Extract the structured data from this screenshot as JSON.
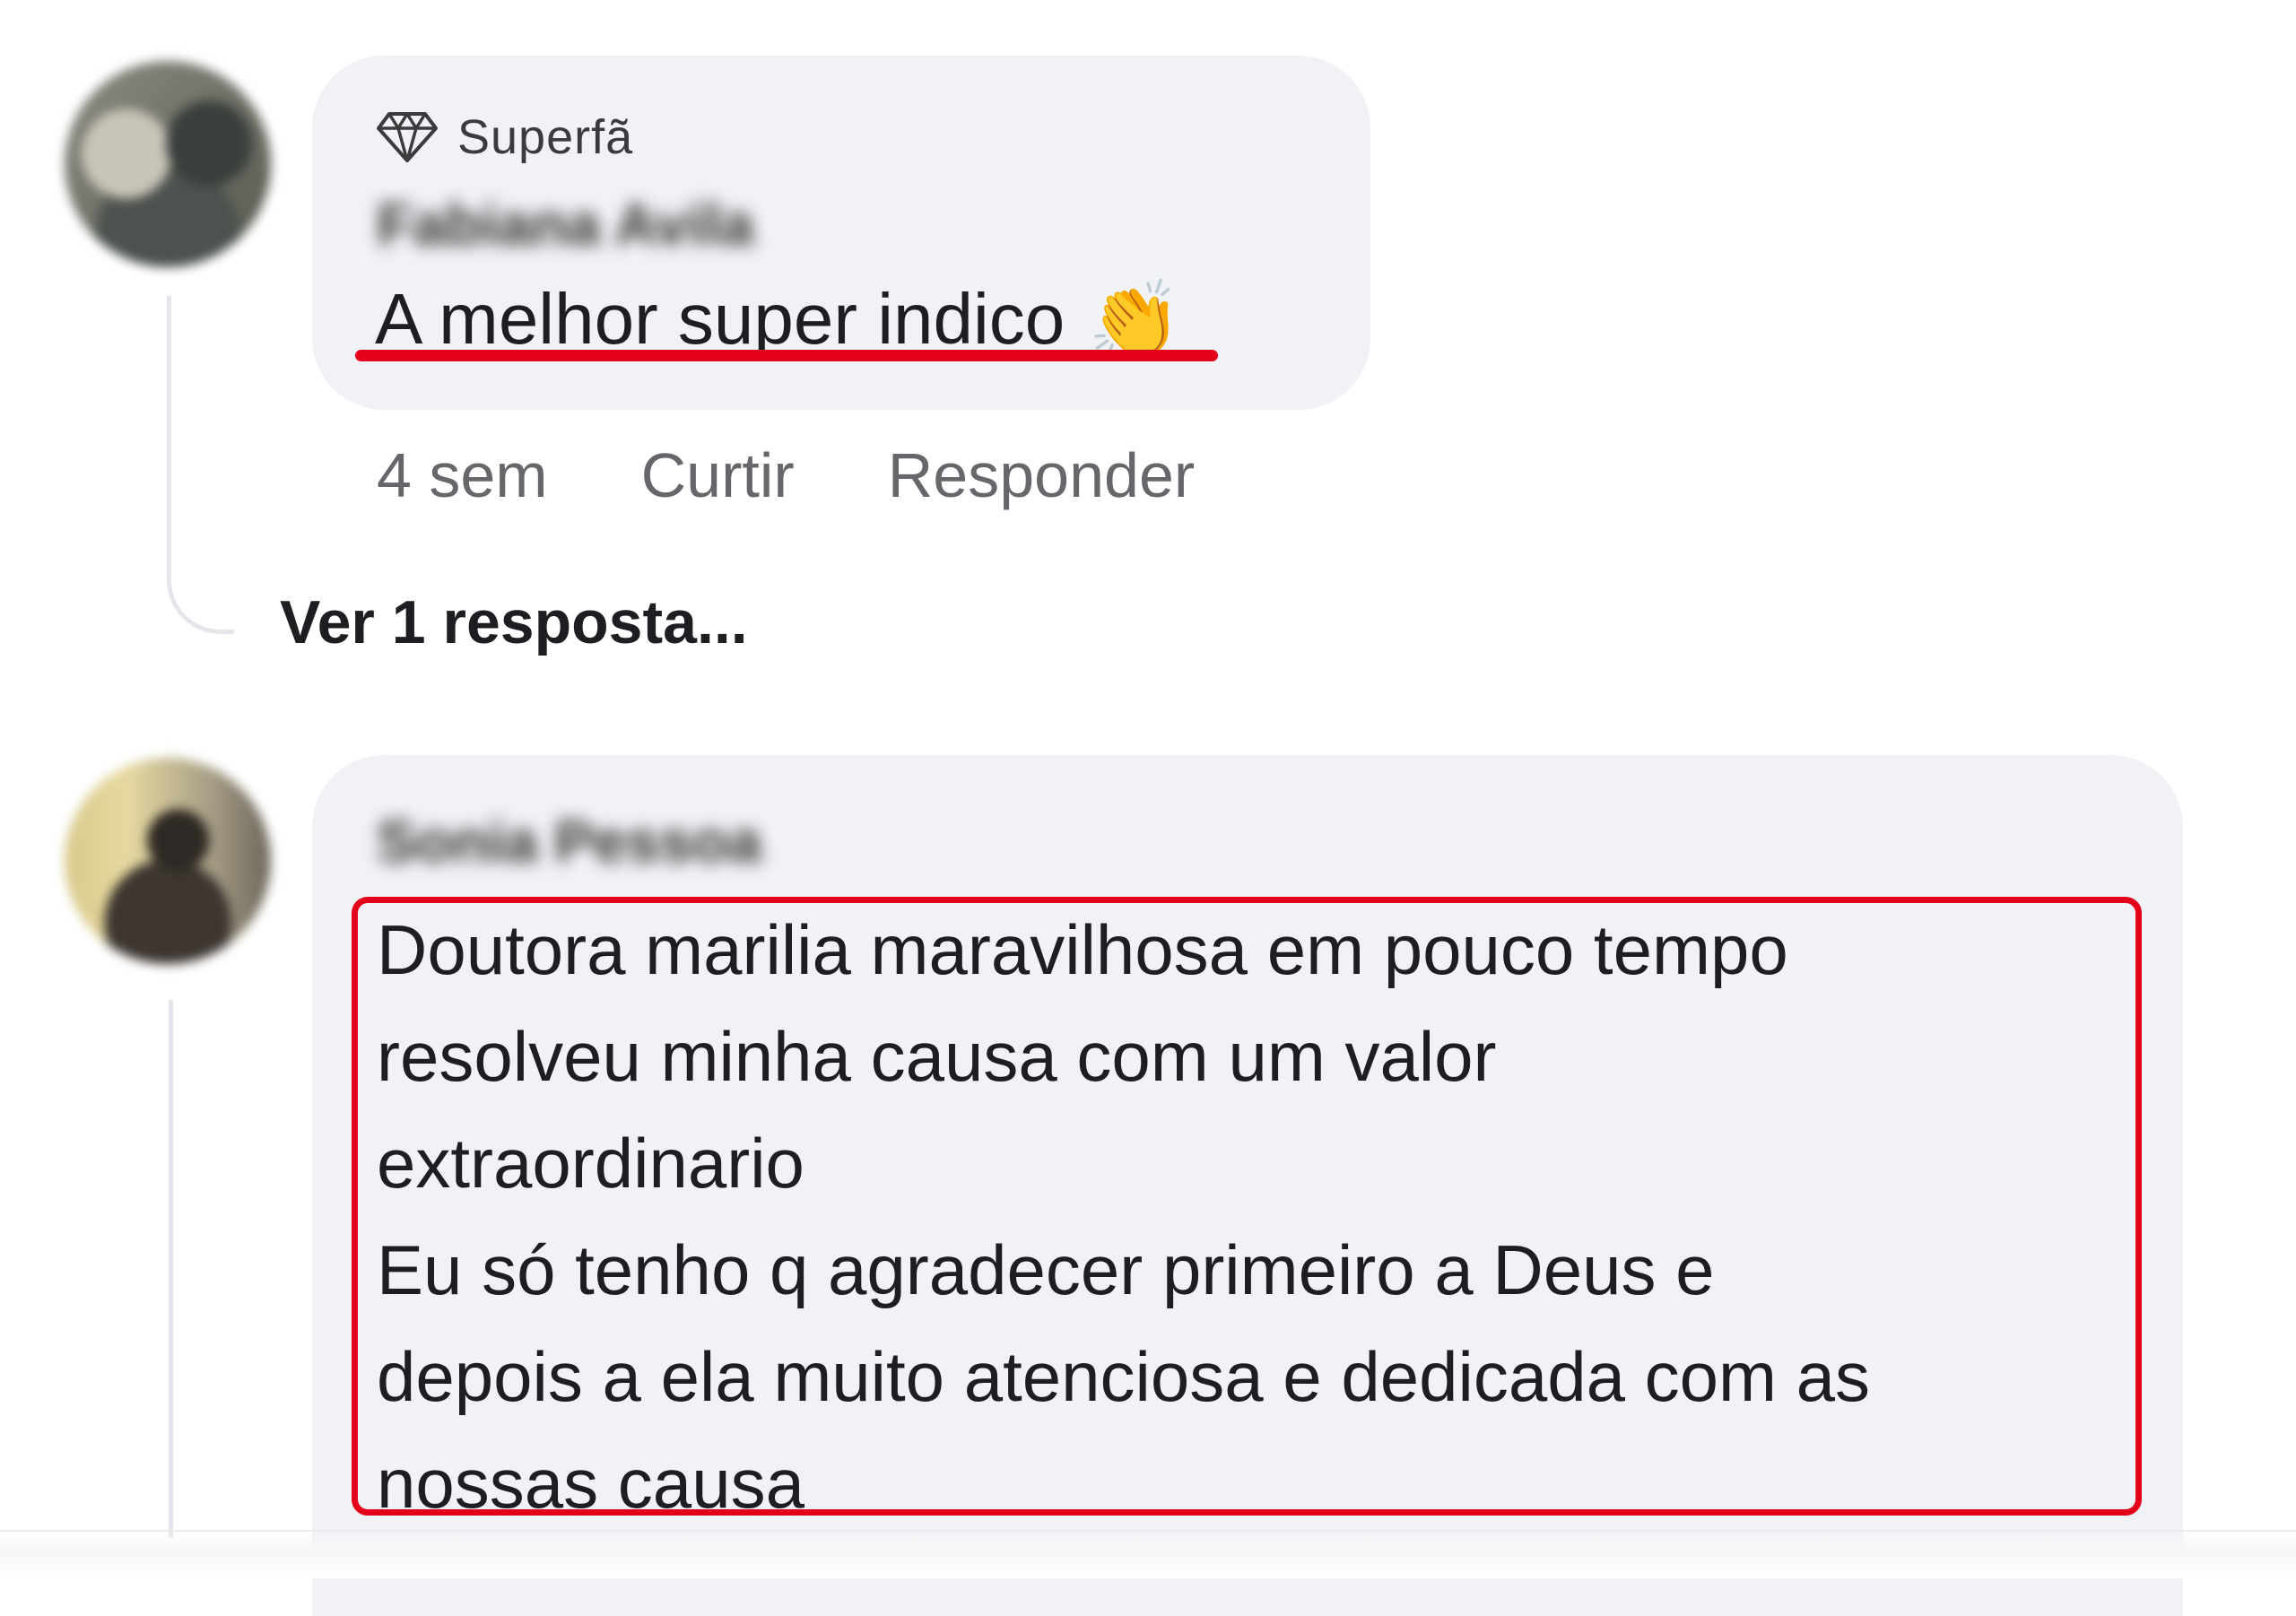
{
  "comments": [
    {
      "badge": {
        "icon": "diamond-icon",
        "label": "Superfã"
      },
      "author": "Fabiana Avila",
      "text": "A melhor super indico",
      "emoji": "👏",
      "meta": {
        "time": "4 sem",
        "like_label": "Curtir",
        "reply_label": "Responder"
      },
      "view_replies": "Ver 1 resposta..."
    },
    {
      "author": "Sonia Pessoa",
      "text_lines": [
        "Doutora marilia maravilhosa em pouco tempo",
        "resolveu minha causa com um valor",
        "extraordinario",
        "Eu só tenho q agradecer primeiro a Deus e",
        "depois a ela muito atenciosa e dedicada com as",
        "nossas causa"
      ]
    }
  ],
  "colors": {
    "bubble": "#f0f2f5",
    "highlight": "#e4001b",
    "meta_text": "#65676b",
    "body_text": "#1c1e21"
  }
}
